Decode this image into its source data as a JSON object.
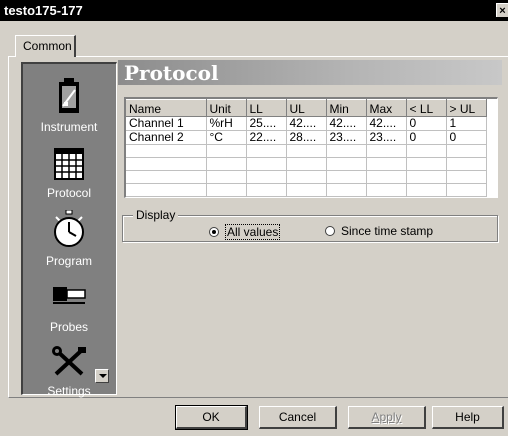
{
  "window": {
    "title": "testo175-177",
    "close_glyph": "×"
  },
  "tabs": [
    {
      "label": "Common",
      "selected": true
    }
  ],
  "sidebar": {
    "items": [
      {
        "label": "Instrument",
        "icon": "instrument-icon"
      },
      {
        "label": "Protocol",
        "icon": "protocol-grid-icon"
      },
      {
        "label": "Program",
        "icon": "stopwatch-icon"
      },
      {
        "label": "Probes",
        "icon": "probe-icon"
      },
      {
        "label": "Settings",
        "icon": "settings-tools-icon"
      }
    ],
    "scroll_icon": "scroll-down-icon"
  },
  "section": {
    "title": "Protocol"
  },
  "protocol_table": {
    "columns": [
      "Name",
      "Unit",
      "LL",
      "UL",
      "Min",
      "Max",
      "< LL",
      "> UL"
    ],
    "rows": [
      [
        "Channel 1",
        "%rH",
        "25....",
        "42....",
        "42....",
        "42....",
        "0",
        "1"
      ],
      [
        "Channel 2",
        "°C",
        "22....",
        "28....",
        "23....",
        "23....",
        "0",
        "0"
      ]
    ]
  },
  "display": {
    "label": "Display",
    "options": [
      {
        "label": "All values",
        "selected": true
      },
      {
        "label": "Since time stamp",
        "selected": false
      }
    ]
  },
  "buttons": {
    "ok": "OK",
    "cancel": "Cancel",
    "apply": "Apply",
    "help": "Help"
  },
  "colors": {
    "titlebar": "#000000",
    "dialog_bg": "#d4d0c8",
    "sidebar_bg": "#808080"
  }
}
